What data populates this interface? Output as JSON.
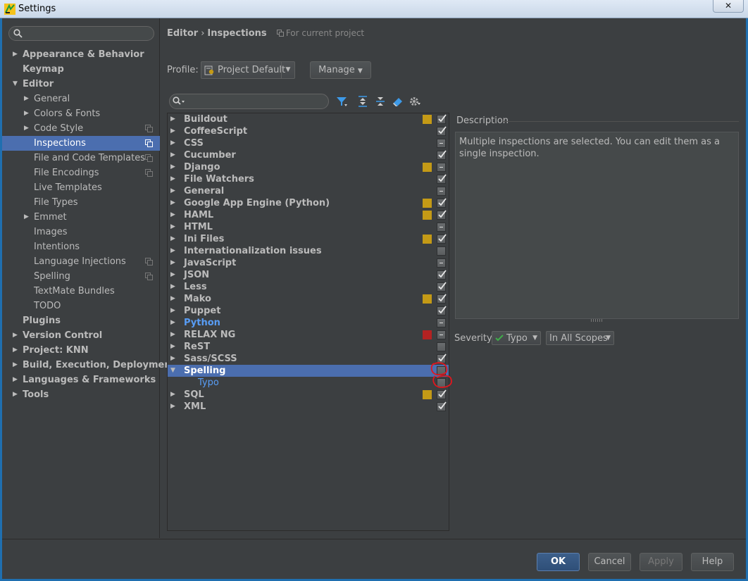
{
  "window": {
    "title": "Settings",
    "close": "✕"
  },
  "sidebar": {
    "items": [
      {
        "label": "Appearance & Behavior",
        "level": 0,
        "arrow": "▶",
        "bold": true
      },
      {
        "label": "Keymap",
        "level": 0,
        "arrow": "",
        "bold": true
      },
      {
        "label": "Editor",
        "level": 0,
        "arrow": "▼",
        "bold": true
      },
      {
        "label": "General",
        "level": 1,
        "arrow": "▶"
      },
      {
        "label": "Colors & Fonts",
        "level": 1,
        "arrow": "▶"
      },
      {
        "label": "Code Style",
        "level": 1,
        "arrow": "▶",
        "copy": true
      },
      {
        "label": "Inspections",
        "level": 1,
        "arrow": "",
        "copy": true,
        "selected": true
      },
      {
        "label": "File and Code Templates",
        "level": 1,
        "arrow": "",
        "copy": true
      },
      {
        "label": "File Encodings",
        "level": 1,
        "arrow": "",
        "copy": true
      },
      {
        "label": "Live Templates",
        "level": 1,
        "arrow": ""
      },
      {
        "label": "File Types",
        "level": 1,
        "arrow": ""
      },
      {
        "label": "Emmet",
        "level": 1,
        "arrow": "▶"
      },
      {
        "label": "Images",
        "level": 1,
        "arrow": ""
      },
      {
        "label": "Intentions",
        "level": 1,
        "arrow": ""
      },
      {
        "label": "Language Injections",
        "level": 1,
        "arrow": "",
        "copy": true
      },
      {
        "label": "Spelling",
        "level": 1,
        "arrow": "",
        "copy": true
      },
      {
        "label": "TextMate Bundles",
        "level": 1,
        "arrow": ""
      },
      {
        "label": "TODO",
        "level": 1,
        "arrow": ""
      },
      {
        "label": "Plugins",
        "level": 0,
        "arrow": "",
        "bold": true
      },
      {
        "label": "Version Control",
        "level": 0,
        "arrow": "▶",
        "bold": true
      },
      {
        "label": "Project: KNN",
        "level": 0,
        "arrow": "▶",
        "bold": true
      },
      {
        "label": "Build, Execution, Deployment",
        "level": 0,
        "arrow": "▶",
        "bold": true
      },
      {
        "label": "Languages & Frameworks",
        "level": 0,
        "arrow": "▶",
        "bold": true
      },
      {
        "label": "Tools",
        "level": 0,
        "arrow": "▶",
        "bold": true
      }
    ]
  },
  "header": {
    "breadcrumb_parent": "Editor",
    "breadcrumb_sep": "›",
    "breadcrumb_current": "Inspections",
    "scope_note": "For current project"
  },
  "profile": {
    "label": "Profile:",
    "value": "Project Default",
    "manage_label": "Manage"
  },
  "tree": {
    "rows": [
      {
        "label": "Buildout",
        "sev": "warning",
        "check": "checked"
      },
      {
        "label": "CoffeeScript",
        "sev": "",
        "check": "checked"
      },
      {
        "label": "CSS",
        "sev": "",
        "check": "partial"
      },
      {
        "label": "Cucumber",
        "sev": "",
        "check": "checked"
      },
      {
        "label": "Django",
        "sev": "warning",
        "check": "partial"
      },
      {
        "label": "File Watchers",
        "sev": "",
        "check": "checked"
      },
      {
        "label": "General",
        "sev": "",
        "check": "partial"
      },
      {
        "label": "Google App Engine (Python)",
        "sev": "warning",
        "check": "checked"
      },
      {
        "label": "HAML",
        "sev": "warning",
        "check": "checked"
      },
      {
        "label": "HTML",
        "sev": "",
        "check": "partial"
      },
      {
        "label": "Ini Files",
        "sev": "warning",
        "check": "checked"
      },
      {
        "label": "Internationalization issues",
        "sev": "",
        "check": "unchecked"
      },
      {
        "label": "JavaScript",
        "sev": "",
        "check": "partial"
      },
      {
        "label": "JSON",
        "sev": "",
        "check": "checked"
      },
      {
        "label": "Less",
        "sev": "",
        "check": "checked"
      },
      {
        "label": "Mako",
        "sev": "warning",
        "check": "checked"
      },
      {
        "label": "Puppet",
        "sev": "",
        "check": "checked"
      },
      {
        "label": "Python",
        "sev": "",
        "check": "partial",
        "blue": true
      },
      {
        "label": "RELAX NG",
        "sev": "error",
        "check": "partial"
      },
      {
        "label": "ReST",
        "sev": "",
        "check": "unchecked"
      },
      {
        "label": "Sass/SCSS",
        "sev": "",
        "check": "checked"
      },
      {
        "label": "Spelling",
        "sev": "",
        "check": "unchecked",
        "expanded": true,
        "selected": true
      },
      {
        "label": "Typo",
        "sev": "",
        "check": "unchecked",
        "child": true
      },
      {
        "label": "SQL",
        "sev": "warning",
        "check": "checked"
      },
      {
        "label": "XML",
        "sev": "",
        "check": "checked"
      }
    ]
  },
  "description": {
    "label": "Description",
    "text": "Multiple inspections are selected. You can edit them as a single inspection."
  },
  "severity": {
    "label": "Severity:",
    "value": "Typo",
    "scope": "In All Scopes"
  },
  "buttons": {
    "ok": "OK",
    "cancel": "Cancel",
    "apply": "Apply",
    "help": "Help"
  },
  "colors": {
    "background": "#3c3f41",
    "selection": "#4b6eaf",
    "warning": "#c49a16",
    "error": "#b42222",
    "link_blue": "#589df6",
    "annotation_red": "#e0161e"
  }
}
